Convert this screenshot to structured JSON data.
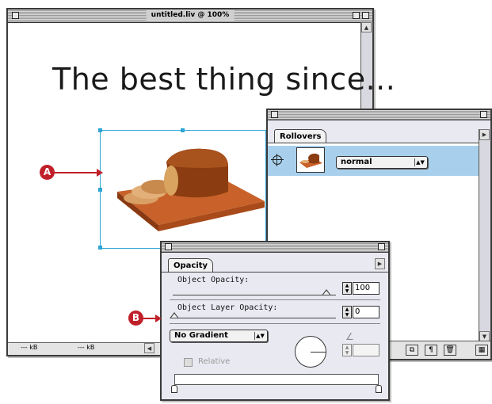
{
  "document": {
    "title": "untitled.liv @ 100%",
    "headline": "The best thing since...",
    "image_desc_icon": "bread-loaf-image",
    "status_left": "--- kB",
    "status_mid": "--- kB"
  },
  "callouts": {
    "a": "A",
    "b": "B"
  },
  "rollovers": {
    "tab": "Rollovers",
    "state_value": "normal"
  },
  "opacity": {
    "tab": "Opacity",
    "object_opacity_label": "Object Opacity:",
    "object_opacity_value": "100",
    "object_opacity_level": 1.0,
    "layer_opacity_label": "Object Layer Opacity:",
    "layer_opacity_value": "0",
    "layer_opacity_level": 0.0,
    "gradient_value": "No Gradient",
    "relative_label": "Relative"
  },
  "colors": {
    "selection": "#2fa6d6",
    "callout": "#c0202a",
    "rollover_row": "#a8d0ec"
  }
}
